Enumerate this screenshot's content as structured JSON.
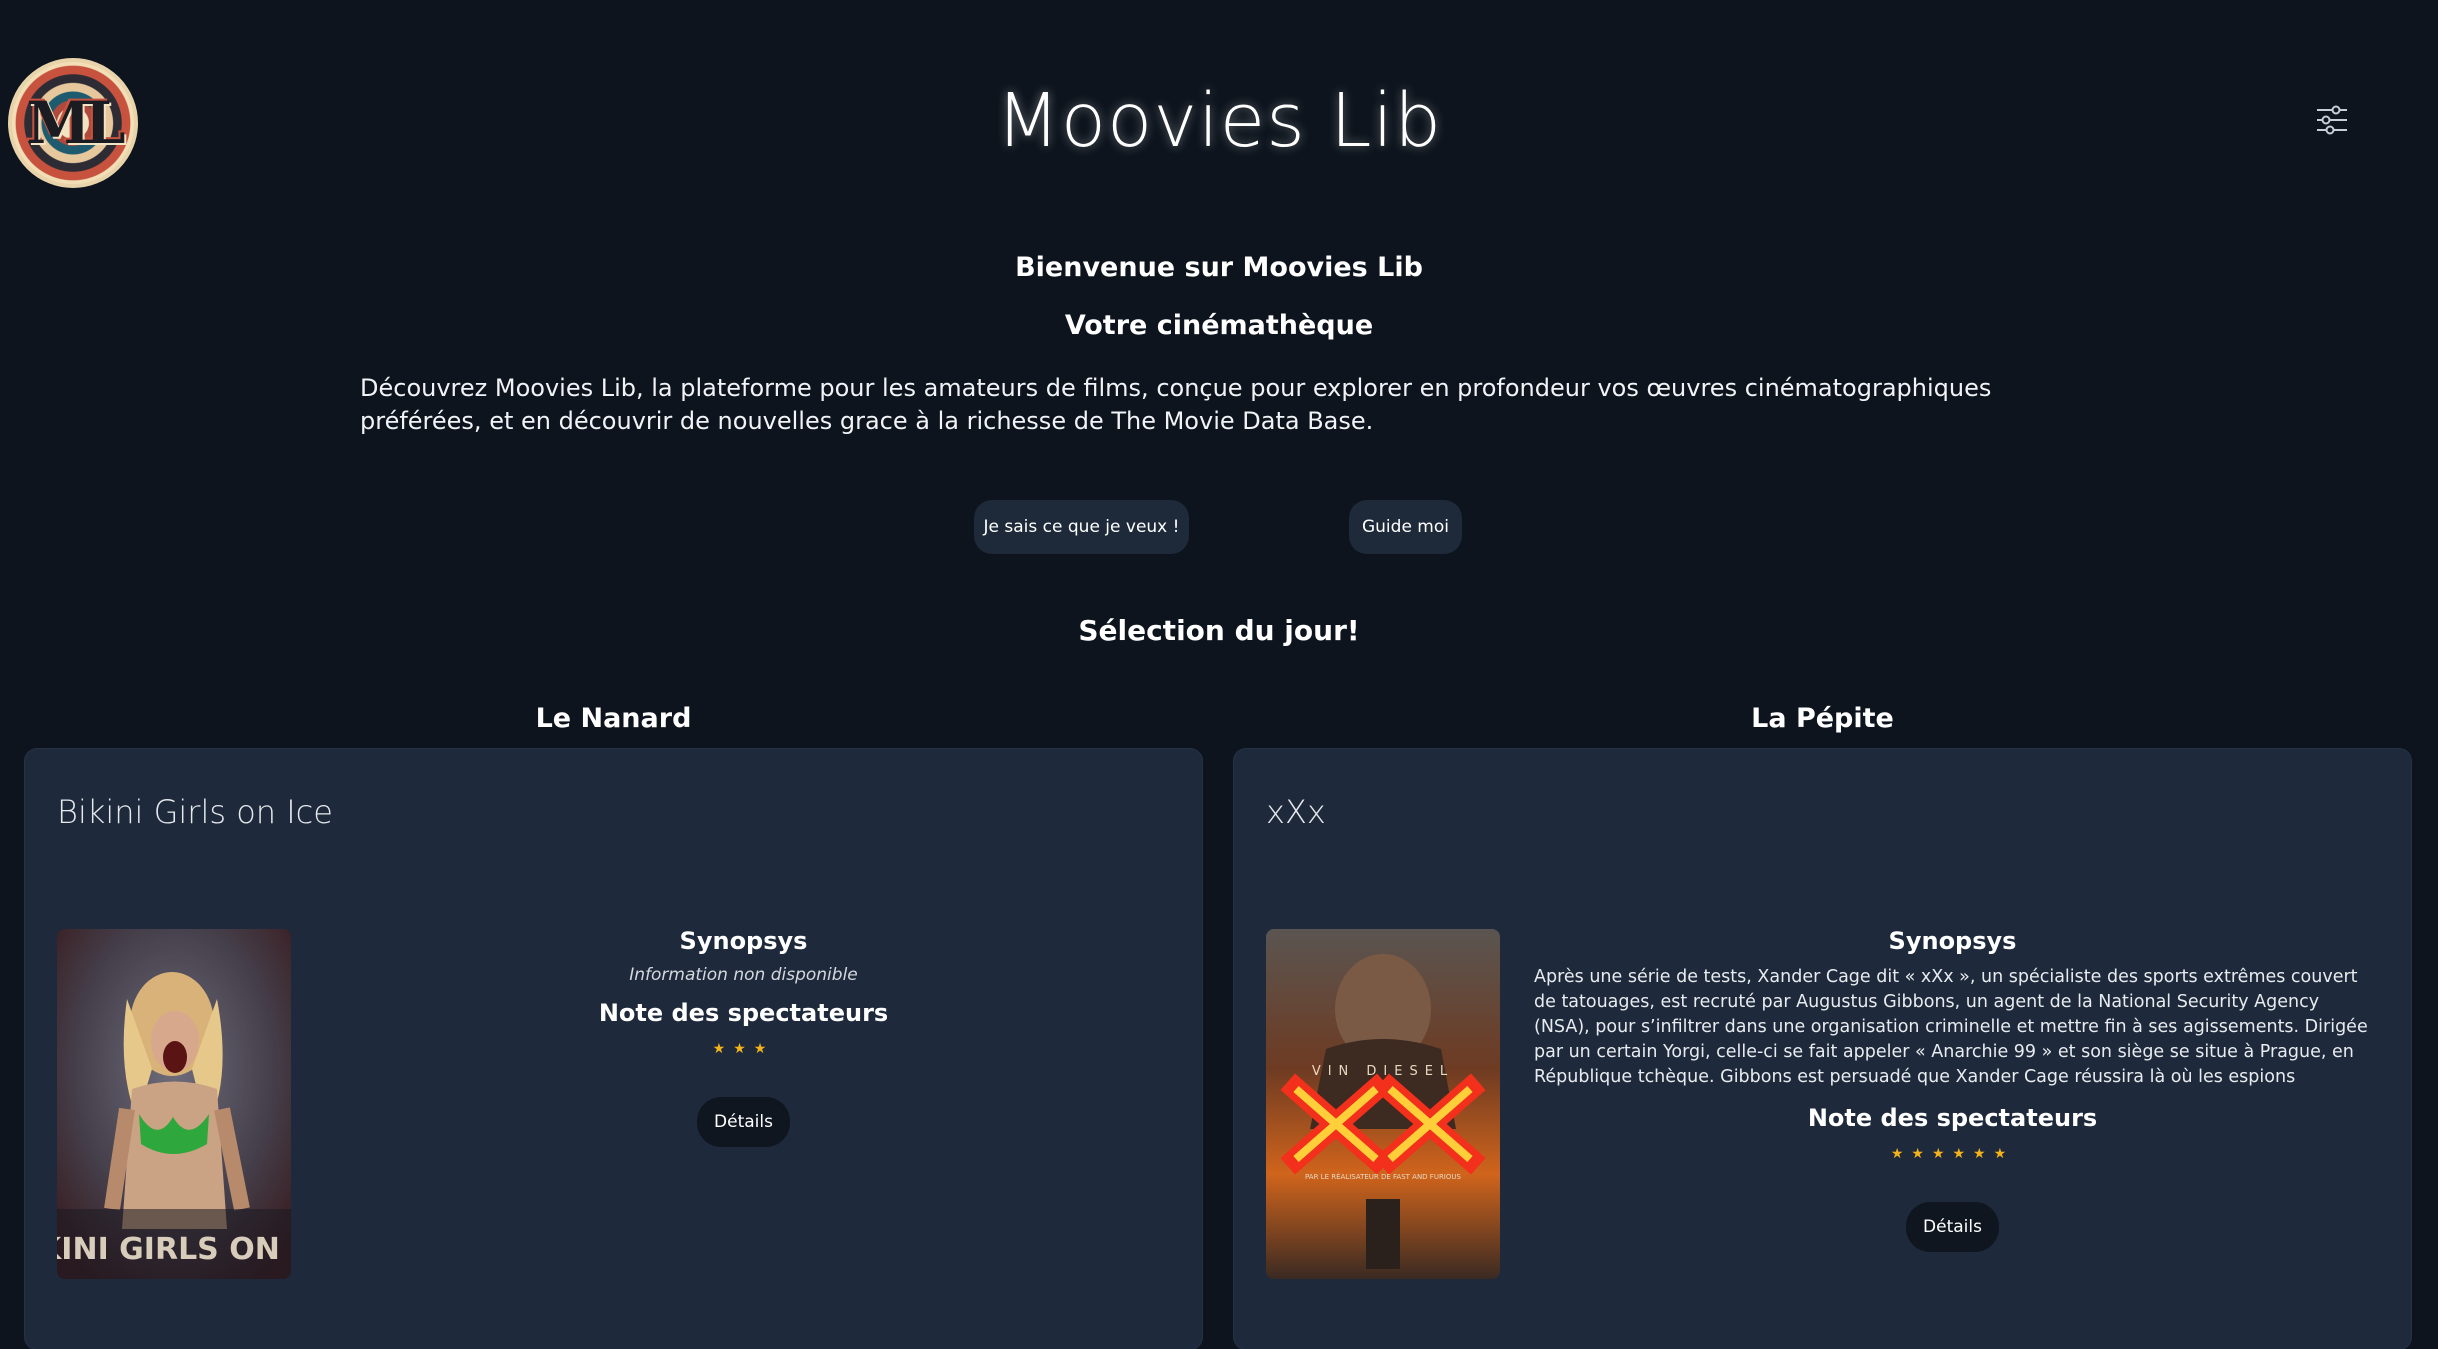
{
  "header": {
    "logo_text": "ML",
    "title": "Moovies Lib",
    "filter_icon": "sliders-icon"
  },
  "hero": {
    "welcome": "Bienvenue sur Moovies Lib",
    "subtitle": "Votre cinémathèque",
    "intro": "Découvrez Moovies Lib, la plateforme pour les amateurs de films, conçue pour explorer en profondeur vos œuvres cinématographiques préférées, et en découvrir de nouvelles grace à la richesse de The Movie Data Base.",
    "button_known": "Je sais ce que je veux !",
    "button_guide": "Guide moi"
  },
  "selection": {
    "title": "Sélection du jour!",
    "left": {
      "heading": "Le Nanard",
      "movie_title": "Bikini Girls on Ice",
      "poster_caption": "BIKINI GIRLS ON ICE",
      "synopsis_label": "Synopsys",
      "synopsis": "Information non disponible",
      "rating_label": "Note des spectateurs",
      "rating": 3,
      "stars": "★★★",
      "details_label": "Détails"
    },
    "right": {
      "heading": "La Pépite",
      "movie_title": "xXx",
      "poster_caption_top": "VIN DIESEL",
      "poster_caption_bottom": "PAR LE RÉALISATEUR DE FAST AND FURIOUS",
      "synopsis_label": "Synopsys",
      "synopsis": "Après une série de tests, Xander Cage dit « xXx », un spécialiste des sports extrêmes couvert de tatouages, est recruté par Augustus Gibbons, un agent de la National Security Agency (NSA), pour s’infiltrer dans une organisation criminelle et mettre fin à ses agissements. Dirigée par un certain Yorgi, celle-ci se fait appeler « Anarchie 99 » et son siège se situe à Prague, en République tchèque. Gibbons est persuadé que Xander Cage réussira là où les espions conventionnels ont échoué.Ce...",
      "rating_label": "Note des spectateurs",
      "rating": 6,
      "stars": "★★★★★★",
      "details_label": "Détails"
    }
  },
  "colors": {
    "background": "#0d141d",
    "card": "#1e2a3b",
    "star": "#f5b31b",
    "button": "#1e2a39"
  }
}
